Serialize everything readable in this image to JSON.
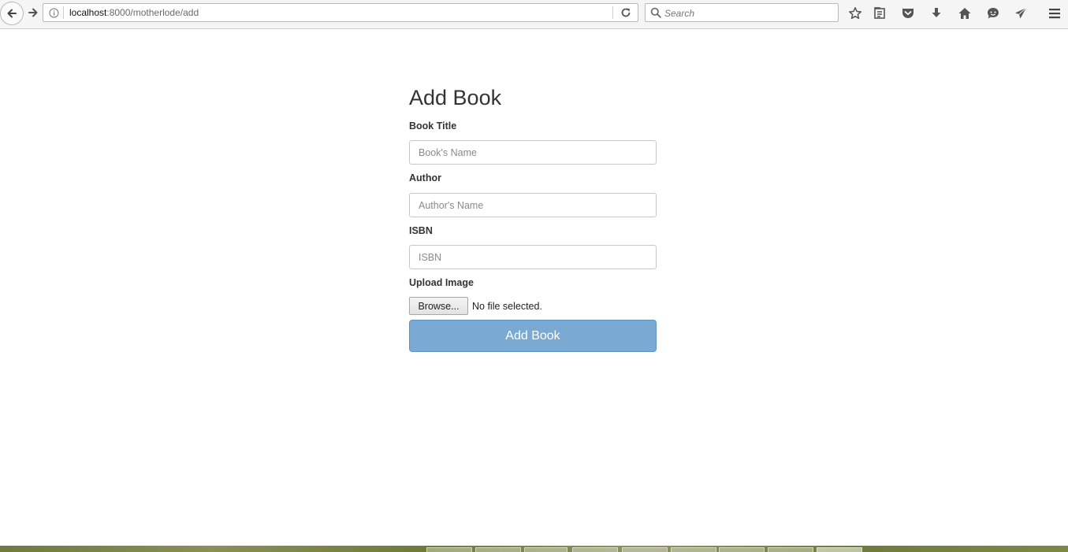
{
  "browser": {
    "url_host": "localhost",
    "url_path": ":8000/motherlode/add",
    "search_placeholder": "Search",
    "icons": [
      "back-arrow-icon",
      "forward-arrow-icon",
      "info-icon",
      "reload-icon",
      "search-icon",
      "bookmark-star-icon",
      "reading-list-icon",
      "pocket-icon",
      "download-icon",
      "home-icon",
      "chat-icon",
      "send-icon",
      "hamburger-menu-icon"
    ]
  },
  "form": {
    "title": "Add Book",
    "fields": [
      {
        "label": "Book Title",
        "placeholder": "Book's Name"
      },
      {
        "label": "Author",
        "placeholder": "Author's Name"
      },
      {
        "label": "ISBN",
        "placeholder": "ISBN"
      }
    ],
    "upload_label": "Upload Image",
    "browse_label": "Browse...",
    "file_status": "No file selected.",
    "submit_label": "Add Book"
  },
  "colors": {
    "submit_button": "#7aaad4",
    "page_background": "#ffffff"
  }
}
